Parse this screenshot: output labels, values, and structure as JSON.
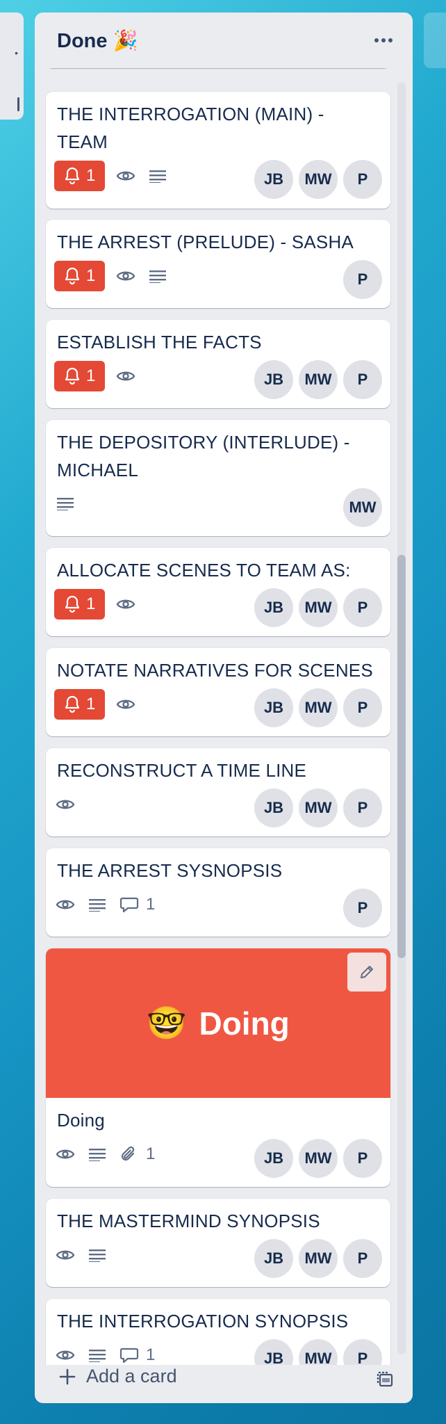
{
  "list": {
    "title": "Done 🎉"
  },
  "cards": [
    {
      "title": "THE INTERROGATION (MAIN) - TEAM",
      "notifications": "1",
      "members": [
        "JB",
        "MW",
        "P"
      ]
    },
    {
      "title": "THE ARREST (PRELUDE) - SASHA",
      "notifications": "1",
      "members": [
        "P"
      ]
    },
    {
      "title": "ESTABLISH THE FACTS",
      "notifications": "1",
      "members": [
        "JB",
        "MW",
        "P"
      ]
    },
    {
      "title": "THE DEPOSITORY (INTERLUDE) - MICHAEL",
      "members": [
        "MW"
      ]
    },
    {
      "title": "ALLOCATE SCENES TO TEAM AS:",
      "notifications": "1",
      "members": [
        "JB",
        "MW",
        "P"
      ]
    },
    {
      "title": "NOTATE NARRATIVES FOR SCENES",
      "notifications": "1",
      "members": [
        "JB",
        "MW",
        "P"
      ]
    },
    {
      "title": "RECONSTRUCT A TIME LINE",
      "members": [
        "JB",
        "MW",
        "P"
      ]
    },
    {
      "title": "THE ARREST SYSNOPSIS",
      "comments": "1",
      "members": [
        "P"
      ]
    },
    {
      "cover_emoji": "🤓",
      "cover_text": "Doing",
      "title": "Doing",
      "attachments": "1",
      "members": [
        "JB",
        "MW",
        "P"
      ]
    },
    {
      "title": "THE MASTERMIND SYNOPSIS",
      "members": [
        "JB",
        "MW",
        "P"
      ]
    },
    {
      "title": "THE INTERROGATION SYNOPSIS",
      "comments": "1",
      "members": [
        "JB",
        "MW",
        "P"
      ]
    }
  ],
  "footer": {
    "add_card_label": "Add a card"
  },
  "colors": {
    "alert": "#e34935",
    "cover": "#f05742",
    "list_bg": "#ebecf0"
  }
}
